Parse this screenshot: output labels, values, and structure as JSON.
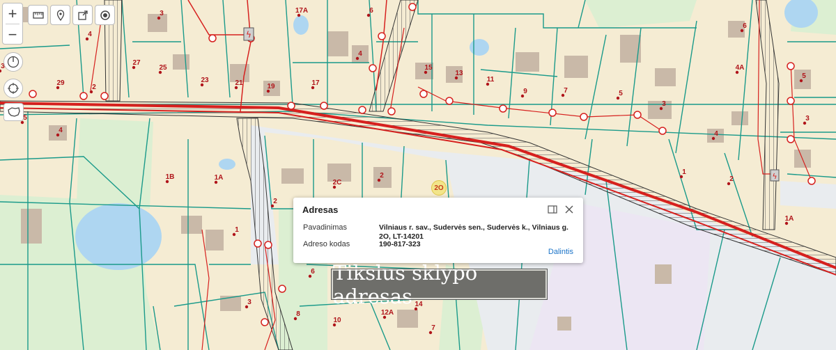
{
  "map": {
    "parcel_numbers": [
      "3",
      "17A",
      "6",
      "4",
      "27",
      "25",
      "23",
      "21",
      "19",
      "17",
      "15",
      "13",
      "11",
      "9",
      "7",
      "5",
      "3",
      "29",
      "2",
      "4",
      "4A",
      "5",
      "4",
      "3",
      "1",
      "2",
      "1B",
      "1A",
      "2C",
      "2",
      "2",
      "1",
      "1A",
      "6",
      "3",
      "8",
      "10",
      "12A",
      "14",
      "6",
      "7",
      "3",
      "4",
      "5"
    ],
    "colors": {
      "parcel_fill": "#f5ecd3",
      "green_area": "#dcefd2",
      "water": "#aed6f1",
      "boundary": "#1a9a8a",
      "road_line": "#d6201e",
      "hatch": "#333333"
    }
  },
  "controls": {
    "zoom_in": "+",
    "zoom_out": "−",
    "icons": [
      "ruler-icon",
      "pin-icon",
      "share-icon",
      "target-icon",
      "compass-icon",
      "locate-icon",
      "country-icon"
    ]
  },
  "marker": {
    "label": "2O"
  },
  "popup": {
    "title": "Adresas",
    "rows": [
      {
        "label": "Pavadinimas",
        "value": "Vilniaus r. sav., Sudervės sen., Sudervės k., Vilniaus g. 2O, LT-14201"
      },
      {
        "label": "Adreso kodas",
        "value": "190-817-323"
      }
    ],
    "link": "Dalintis"
  },
  "caption": "Tikslus sklypo adresas"
}
